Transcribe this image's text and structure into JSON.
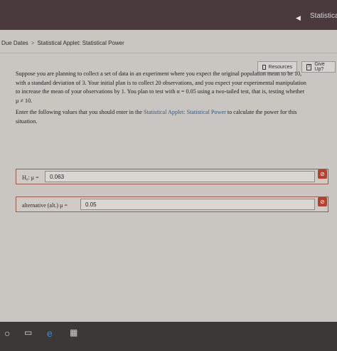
{
  "window": {
    "title_fragment": "Statistical A"
  },
  "breadcrumb": {
    "item1": "Due Dates",
    "separator": ">",
    "item2": "Statistical Applet: Statistical Power"
  },
  "toolbar": {
    "resources_label": "Resources",
    "giveup_label": "Give Up?"
  },
  "question": {
    "line1": "Suppose you are planning to collect a set of data in an experiment where you expect the original population mean to be 10,",
    "line2": "with a standard deviation of 3. Your initial plan is to collect 20 observations, and you expect your experimental manipulation",
    "line3": "to increase the mean of your observations by 1. You plan to test with α = 0.05 using a two-tailed test, that is, testing whether",
    "line4": "μ ≠ 10.",
    "instr_part1": "Enter the following values that you should enter in the",
    "instr_link": "Statistical Applet: Statistical Power",
    "instr_part2": "to calculate the power for this",
    "instr_line2": "situation."
  },
  "fields": {
    "h0_label": "H₀: μ =",
    "h0_value": "0.063",
    "alt_label": "alternative (alt.) μ =",
    "alt_value": "0.05"
  },
  "status": {
    "error_glyph": "⊘"
  },
  "icons": [
    "chevron-left-icon",
    "resources-icon",
    "give-up-icon",
    "error-icon",
    "windows-start-icon",
    "task-view-icon",
    "edge-icon",
    "store-icon"
  ]
}
